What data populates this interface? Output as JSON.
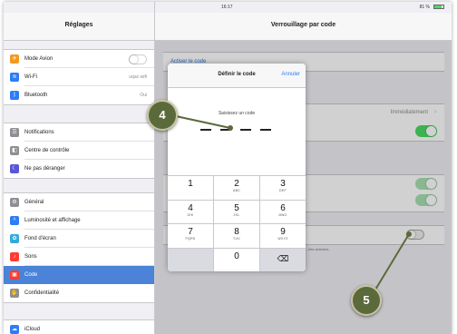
{
  "status": {
    "device": "iPad",
    "time": "16:17",
    "battery": "81 %"
  },
  "left": {
    "title": "Réglages",
    "group1": [
      {
        "label": "Mode Avion",
        "icon": "airplane-icon",
        "color": "#f29a1f"
      },
      {
        "label": "Wi-Fi",
        "value": "uqac-wifi",
        "icon": "wifi-icon",
        "color": "#2f7cf6"
      },
      {
        "label": "Bluetooth",
        "value": "Oui",
        "icon": "bluetooth-icon",
        "color": "#2f7cf6"
      }
    ],
    "group2": [
      {
        "label": "Notifications",
        "icon": "notifications-icon",
        "color": "#8e8e93"
      },
      {
        "label": "Centre de contrôle",
        "icon": "control-center-icon",
        "color": "#8e8e93"
      },
      {
        "label": "Ne pas déranger",
        "icon": "moon-icon",
        "color": "#5856d6"
      }
    ],
    "group3": [
      {
        "label": "Général",
        "icon": "gear-icon",
        "color": "#8e8e93"
      },
      {
        "label": "Luminosité et affichage",
        "icon": "brightness-icon",
        "color": "#2f7cf6"
      },
      {
        "label": "Fond d'écran",
        "icon": "wallpaper-icon",
        "color": "#34aadc"
      },
      {
        "label": "Sons",
        "icon": "sound-icon",
        "color": "#ff3b30"
      },
      {
        "label": "Code",
        "icon": "lock-icon",
        "color": "#ff3b30"
      },
      {
        "label": "Confidentialité",
        "icon": "hand-icon",
        "color": "#8e8e93"
      }
    ],
    "group4": [
      {
        "label": "iCloud",
        "icon": "cloud-icon",
        "color": "#2f7cf6"
      }
    ]
  },
  "right": {
    "title": "Verrouillage par code",
    "activate_link": "Activer le code",
    "immediately": "Immédiatement",
    "chevron": ">",
    "footnote": "...ités activées."
  },
  "dialog": {
    "title": "Définir le code",
    "cancel": "Annuler",
    "prompt": "Saisissez un code",
    "keys": [
      {
        "n": "1",
        "s": ""
      },
      {
        "n": "2",
        "s": "ABC"
      },
      {
        "n": "3",
        "s": "DEF"
      },
      {
        "n": "4",
        "s": "GHI"
      },
      {
        "n": "5",
        "s": "JKL"
      },
      {
        "n": "6",
        "s": "MNO"
      },
      {
        "n": "7",
        "s": "PQRS"
      },
      {
        "n": "8",
        "s": "TUV"
      },
      {
        "n": "9",
        "s": "WXYZ"
      },
      {
        "n": "",
        "s": ""
      },
      {
        "n": "0",
        "s": ""
      },
      {
        "n": "⌫",
        "s": ""
      }
    ]
  },
  "callouts": {
    "a": "4",
    "b": "5"
  },
  "colors": {
    "accent": "#2f7cf6",
    "selected": "#4a83d7",
    "toggle_on": "#4cd964",
    "callout": "#5b6a3a"
  }
}
